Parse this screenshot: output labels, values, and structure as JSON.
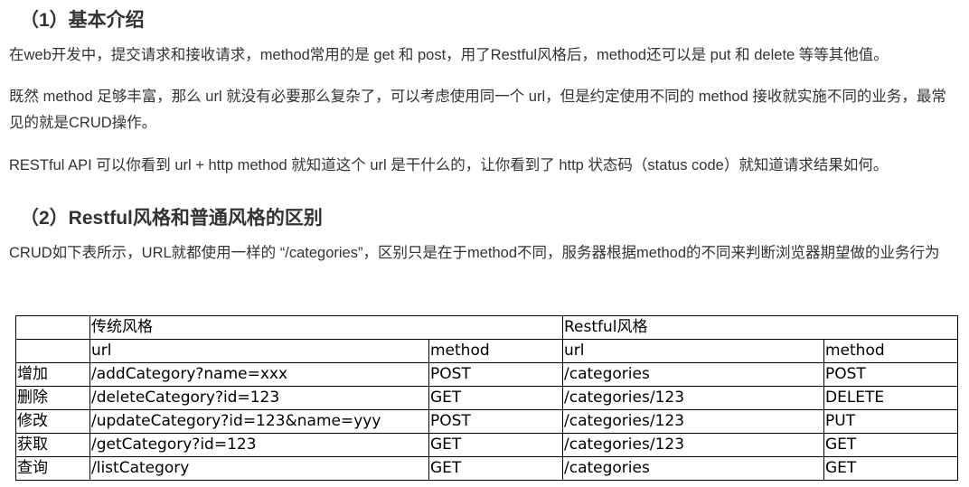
{
  "section1": {
    "heading": "（1）基本介绍",
    "paragraphs": [
      "在web开发中，提交请求和接收请求，method常用的是 get 和 post，用了Restful风格后，method还可以是 put 和 delete 等等其他值。",
      "既然 method 足够丰富，那么 url 就没有必要那么复杂了，可以考虑使用同一个 url，但是约定使用不同的 method 接收就实施不同的业务，最常见的就是CRUD操作。",
      "RESTful API 可以你看到 url + http method 就知道这个 url 是干什么的，让你看到了 http 状态码（status code）就知道请求结果如何。"
    ]
  },
  "section2": {
    "heading": "（2）Restful风格和普通风格的区别",
    "paragraph": "CRUD如下表所示，URL就都使用一样的 “/categories”，区别只是在于method不同，服务器根据method的不同来判断浏览器期望做的业务行为"
  },
  "table": {
    "group_headers": [
      "传统风格",
      "Restful风格"
    ],
    "sub_headers": [
      "url",
      "method",
      "url",
      "method"
    ],
    "rows": [
      [
        "增加",
        "/addCategory?name=xxx",
        "POST",
        "/categories",
        "POST"
      ],
      [
        "删除",
        "/deleteCategory?id=123",
        "GET",
        "/categories/123",
        "DELETE"
      ],
      [
        "修改",
        "/updateCategory?id=123&name=yyy",
        "POST",
        "/categories/123",
        "PUT"
      ],
      [
        "获取",
        "/getCategory?id=123",
        "GET",
        "/categories/123",
        "GET"
      ],
      [
        "查询",
        "/listCategory",
        "GET",
        "/categories",
        "GET"
      ]
    ]
  }
}
